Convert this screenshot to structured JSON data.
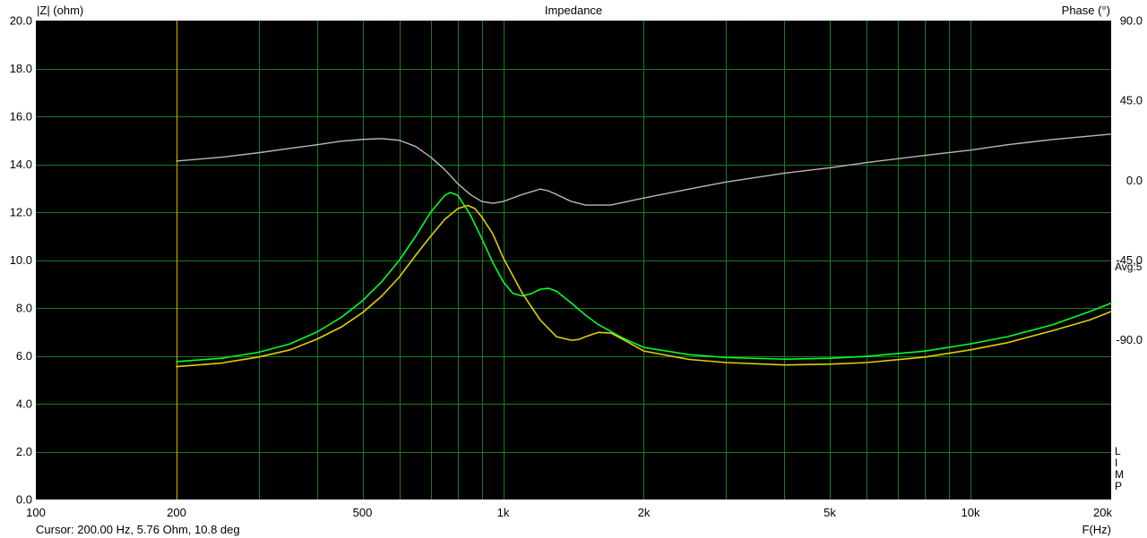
{
  "chart_data": {
    "type": "line",
    "title": "Impedance",
    "ylabel": "|Z| (ohm)",
    "y2label": "Phase (°)",
    "xlabel": "F(Hz)",
    "x_scale": "log",
    "xlim": [
      100,
      20000
    ],
    "ylim": [
      0,
      20
    ],
    "y2lim": [
      -180,
      90
    ],
    "x_ticks": [
      {
        "value": 100,
        "label": "100"
      },
      {
        "value": 200,
        "label": "200"
      },
      {
        "value": 500,
        "label": "500"
      },
      {
        "value": 1000,
        "label": "1k"
      },
      {
        "value": 2000,
        "label": "2k"
      },
      {
        "value": 5000,
        "label": "5k"
      },
      {
        "value": 10000,
        "label": "10k"
      },
      {
        "value": 20000,
        "label": "20k"
      }
    ],
    "y_ticks": [
      "0.0",
      "2.0",
      "4.0",
      "6.0",
      "8.0",
      "10.0",
      "12.0",
      "14.0",
      "16.0",
      "18.0",
      "20.0"
    ],
    "y2_ticks": [
      {
        "value": 90,
        "label": "90.0"
      },
      {
        "value": 45,
        "label": "45.0"
      },
      {
        "value": 0,
        "label": "0.0"
      },
      {
        "value": -45,
        "label": "-45.0"
      },
      {
        "value": -90,
        "label": "-90.0"
      }
    ],
    "grid": true,
    "background": "#000000",
    "grid_color": "#1e7a1e",
    "cursor_freq": 200,
    "cursor_color": "#c8a000",
    "series": [
      {
        "axis": "left",
        "color": "#00ff30",
        "points": [
          [
            200,
            5.76
          ],
          [
            250,
            5.9
          ],
          [
            300,
            6.15
          ],
          [
            350,
            6.5
          ],
          [
            400,
            7.0
          ],
          [
            450,
            7.6
          ],
          [
            500,
            8.3
          ],
          [
            550,
            9.1
          ],
          [
            600,
            10.0
          ],
          [
            650,
            11.0
          ],
          [
            700,
            12.0
          ],
          [
            750,
            12.7
          ],
          [
            770,
            12.82
          ],
          [
            800,
            12.7
          ],
          [
            850,
            11.9
          ],
          [
            900,
            10.9
          ],
          [
            950,
            9.9
          ],
          [
            1000,
            9.1
          ],
          [
            1050,
            8.6
          ],
          [
            1100,
            8.5
          ],
          [
            1150,
            8.6
          ],
          [
            1200,
            8.78
          ],
          [
            1250,
            8.82
          ],
          [
            1300,
            8.7
          ],
          [
            1400,
            8.2
          ],
          [
            1500,
            7.7
          ],
          [
            1600,
            7.3
          ],
          [
            1800,
            6.75
          ],
          [
            2000,
            6.35
          ],
          [
            2500,
            6.05
          ],
          [
            3000,
            5.93
          ],
          [
            4000,
            5.86
          ],
          [
            5000,
            5.9
          ],
          [
            6000,
            5.98
          ],
          [
            8000,
            6.2
          ],
          [
            10000,
            6.5
          ],
          [
            12000,
            6.8
          ],
          [
            15000,
            7.3
          ],
          [
            18000,
            7.85
          ],
          [
            20000,
            8.2
          ]
        ]
      },
      {
        "axis": "left",
        "color": "#e0d000",
        "points": [
          [
            200,
            5.55
          ],
          [
            250,
            5.7
          ],
          [
            300,
            5.95
          ],
          [
            350,
            6.25
          ],
          [
            400,
            6.7
          ],
          [
            450,
            7.2
          ],
          [
            500,
            7.8
          ],
          [
            550,
            8.5
          ],
          [
            600,
            9.3
          ],
          [
            650,
            10.2
          ],
          [
            700,
            11.0
          ],
          [
            750,
            11.7
          ],
          [
            800,
            12.15
          ],
          [
            840,
            12.28
          ],
          [
            870,
            12.15
          ],
          [
            900,
            11.8
          ],
          [
            950,
            11.1
          ],
          [
            1000,
            10.1
          ],
          [
            1100,
            8.6
          ],
          [
            1200,
            7.5
          ],
          [
            1300,
            6.8
          ],
          [
            1400,
            6.65
          ],
          [
            1450,
            6.68
          ],
          [
            1500,
            6.8
          ],
          [
            1600,
            6.98
          ],
          [
            1700,
            6.95
          ],
          [
            1800,
            6.7
          ],
          [
            2000,
            6.2
          ],
          [
            2500,
            5.85
          ],
          [
            3000,
            5.72
          ],
          [
            4000,
            5.62
          ],
          [
            5000,
            5.65
          ],
          [
            6000,
            5.72
          ],
          [
            8000,
            5.95
          ],
          [
            10000,
            6.25
          ],
          [
            12000,
            6.55
          ],
          [
            15000,
            7.05
          ],
          [
            18000,
            7.5
          ],
          [
            20000,
            7.85
          ]
        ]
      },
      {
        "axis": "right",
        "color": "#b8b8b8",
        "points": [
          [
            200,
            10.8
          ],
          [
            250,
            13
          ],
          [
            300,
            15.5
          ],
          [
            350,
            18
          ],
          [
            400,
            20
          ],
          [
            450,
            22
          ],
          [
            500,
            23
          ],
          [
            550,
            23.5
          ],
          [
            600,
            22.5
          ],
          [
            650,
            19
          ],
          [
            700,
            13
          ],
          [
            750,
            6
          ],
          [
            800,
            -2
          ],
          [
            850,
            -8
          ],
          [
            900,
            -12
          ],
          [
            950,
            -13
          ],
          [
            1000,
            -12
          ],
          [
            1100,
            -8
          ],
          [
            1200,
            -5
          ],
          [
            1250,
            -6
          ],
          [
            1300,
            -8
          ],
          [
            1400,
            -12
          ],
          [
            1500,
            -14
          ],
          [
            1700,
            -14
          ],
          [
            2000,
            -10
          ],
          [
            2500,
            -5
          ],
          [
            3000,
            -1
          ],
          [
            4000,
            4
          ],
          [
            5000,
            7
          ],
          [
            6000,
            10
          ],
          [
            8000,
            14
          ],
          [
            10000,
            17
          ],
          [
            12000,
            20
          ],
          [
            15000,
            23
          ],
          [
            20000,
            26
          ]
        ]
      }
    ]
  },
  "cursor_text": "Cursor: 200.00 Hz, 5.76 Ohm, 10.8 deg",
  "avg_label": "Avg:5",
  "lim_letters": [
    "L",
    "I",
    "M",
    "P"
  ]
}
